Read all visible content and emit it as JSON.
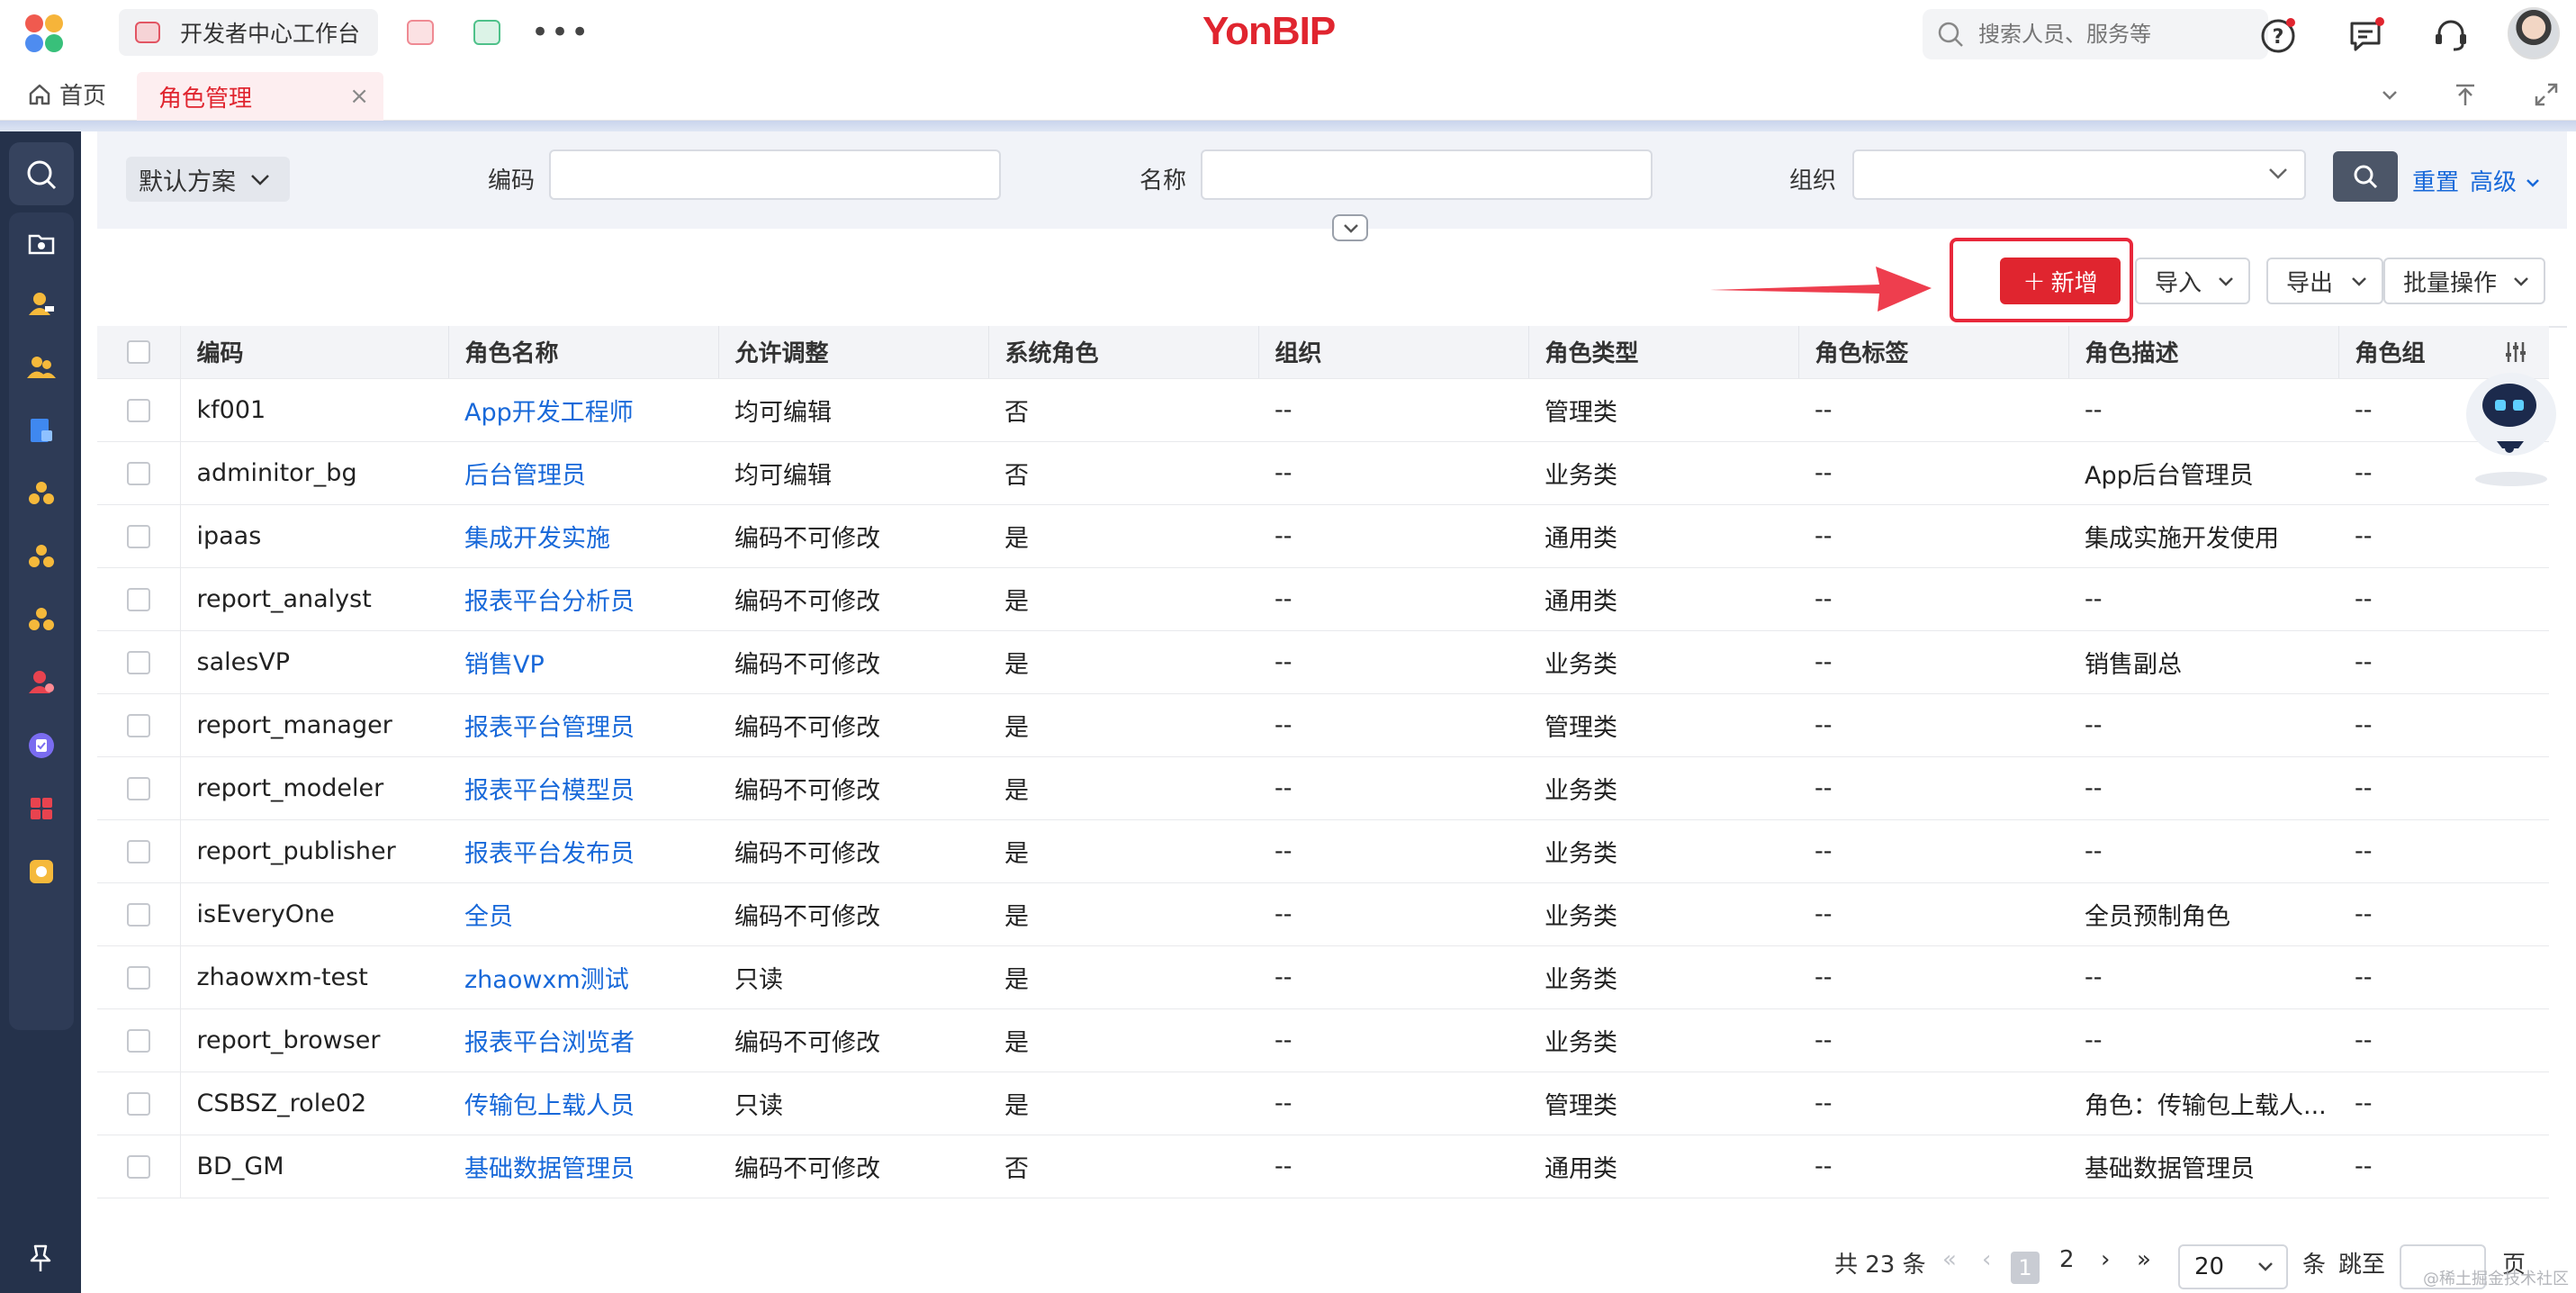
{
  "topbar": {
    "workspace_tab": "开发者中心工作台",
    "brand": "YonBIP",
    "search_placeholder": "搜索人员、服务等",
    "more": "•••"
  },
  "tabs": {
    "home": "首页",
    "active": "角色管理",
    "close": "×"
  },
  "filter": {
    "scheme": "默认方案",
    "code_label": "编码",
    "name_label": "名称",
    "org_label": "组织",
    "reset": "重置",
    "advanced": "高级"
  },
  "toolbar": {
    "add": "新增",
    "import": "导入",
    "export": "导出",
    "batch": "批量操作"
  },
  "table": {
    "columns": [
      "编码",
      "角色名称",
      "允许调整",
      "系统角色",
      "组织",
      "角色类型",
      "角色标签",
      "角色描述",
      "角色组"
    ],
    "rows": [
      [
        "kf001",
        "App开发工程师",
        "均可编辑",
        "否",
        "--",
        "管理类",
        "--",
        "--",
        "--"
      ],
      [
        "adminitor_bg",
        "后台管理员",
        "均可编辑",
        "否",
        "--",
        "业务类",
        "--",
        "App后台管理员",
        "--"
      ],
      [
        "ipaas",
        "集成开发实施",
        "编码不可修改",
        "是",
        "--",
        "通用类",
        "--",
        "集成实施开发使用",
        "--"
      ],
      [
        "report_analyst",
        "报表平台分析员",
        "编码不可修改",
        "是",
        "--",
        "通用类",
        "--",
        "--",
        "--"
      ],
      [
        "salesVP",
        "销售VP",
        "编码不可修改",
        "是",
        "--",
        "业务类",
        "--",
        "销售副总",
        "--"
      ],
      [
        "report_manager",
        "报表平台管理员",
        "编码不可修改",
        "是",
        "--",
        "管理类",
        "--",
        "--",
        "--"
      ],
      [
        "report_modeler",
        "报表平台模型员",
        "编码不可修改",
        "是",
        "--",
        "业务类",
        "--",
        "--",
        "--"
      ],
      [
        "report_publisher",
        "报表平台发布员",
        "编码不可修改",
        "是",
        "--",
        "业务类",
        "--",
        "--",
        "--"
      ],
      [
        "isEveryOne",
        "全员",
        "编码不可修改",
        "是",
        "--",
        "业务类",
        "--",
        "全员预制角色",
        "--"
      ],
      [
        "zhaowxm-test",
        "zhaowxm测试",
        "只读",
        "是",
        "--",
        "业务类",
        "--",
        "--",
        "--"
      ],
      [
        "report_browser",
        "报表平台浏览者",
        "编码不可修改",
        "是",
        "--",
        "业务类",
        "--",
        "--",
        "--"
      ],
      [
        "CSBSZ_role02",
        "传输包上载人员",
        "只读",
        "是",
        "--",
        "管理类",
        "--",
        "角色：传输包上载人...",
        "--"
      ],
      [
        "BD_GM",
        "基础数据管理员",
        "编码不可修改",
        "否",
        "--",
        "通用类",
        "--",
        "基础数据管理员",
        "--"
      ]
    ]
  },
  "pagination": {
    "total": "共 23 条",
    "current_page": "1",
    "page2": "2",
    "page_size": "20",
    "unit": "条",
    "jump": "跳至",
    "page_word": "页"
  },
  "watermark": "@稀土掘金技术社区",
  "colors": {
    "brand_red": "#e0252f",
    "link_blue": "#1768d9",
    "nav_dark": "#25324b"
  }
}
